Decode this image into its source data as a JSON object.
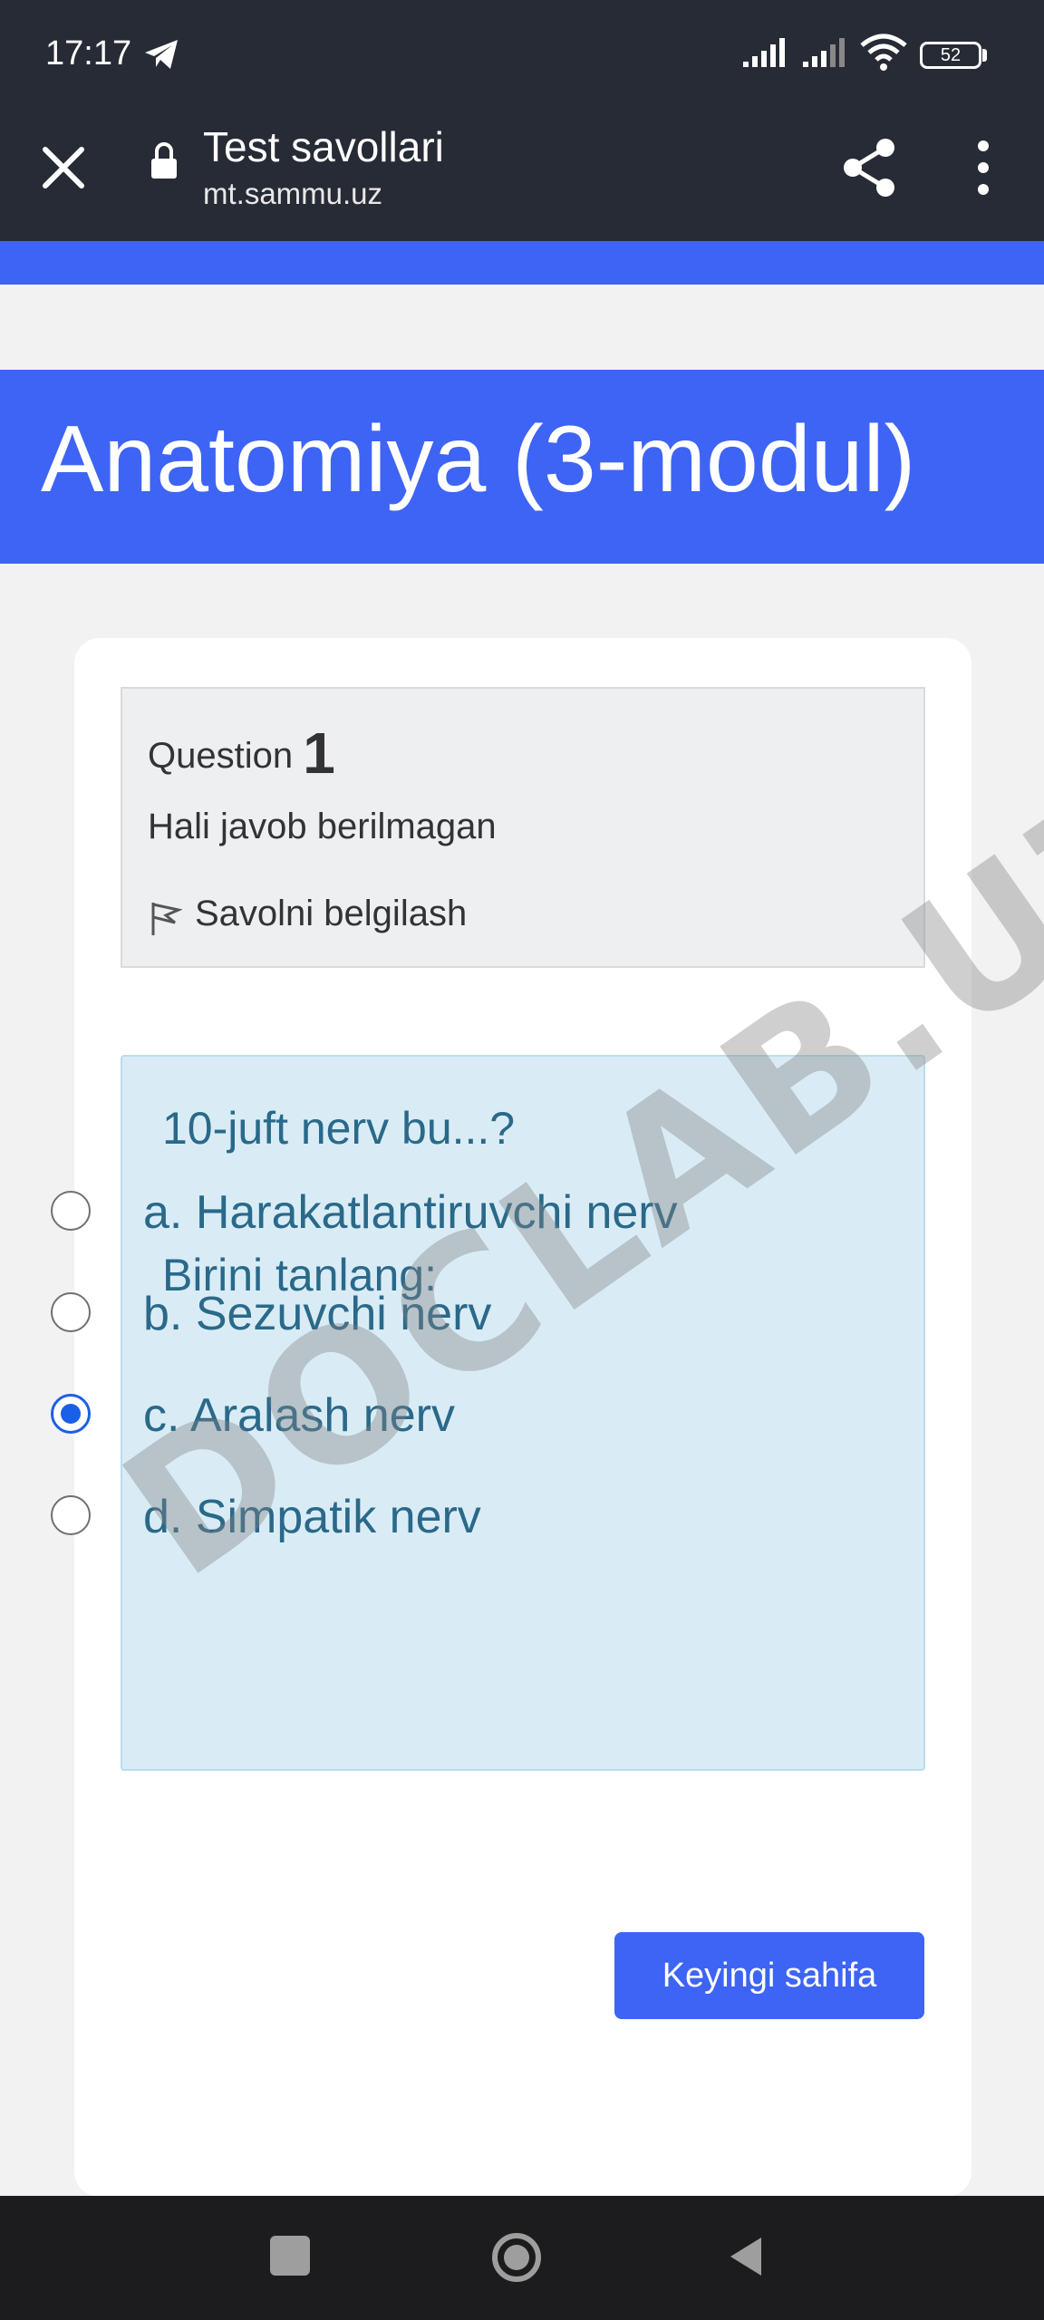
{
  "status_bar": {
    "time": "17:17",
    "battery": "52",
    "icons": [
      "telegram-icon",
      "signal-icon",
      "signal-icon",
      "wifi-icon",
      "battery-icon"
    ]
  },
  "browser": {
    "title": "Test savollari",
    "url": "mt.sammu.uz",
    "icons": [
      "close-icon",
      "lock-icon",
      "share-icon",
      "more-vert-icon"
    ]
  },
  "page": {
    "course_title": "Anatomiya (3-modul)"
  },
  "question_info": {
    "label": "Question",
    "number": "1",
    "status": "Hali javob berilmagan",
    "flag_text": "Savolni belgilash"
  },
  "question": {
    "text": "10-juft nerv bu...?",
    "prompt": "Birini tanlang:",
    "options": [
      {
        "label": "a. Harakatlantiruvchi nerv",
        "selected": false
      },
      {
        "label": "b. Sezuvchi nerv",
        "selected": false
      },
      {
        "label": "c. Aralash nerv",
        "selected": true
      },
      {
        "label": "d. Simpatik nerv",
        "selected": false
      }
    ]
  },
  "actions": {
    "next_label": "Keyingi sahifa"
  },
  "watermark": "DOCLAB.UZ",
  "colors": {
    "top_bar": "#272b35",
    "brand_blue": "#3e64f5",
    "question_bg": "#d9ecf6",
    "question_text": "#2a6989",
    "radio_selected": "#1a5fe8"
  }
}
